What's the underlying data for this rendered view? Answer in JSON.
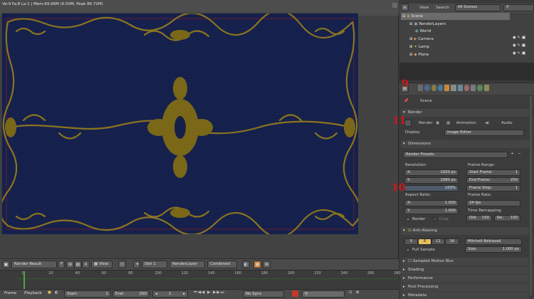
{
  "info": {
    "text": "Ve:9 Fa:8 La:1 | Mem:69.66M (0.00M, Peak 86.72M)"
  },
  "outliner": {
    "view_label": "View",
    "search_label": "Search",
    "scenes_label": "All Scenes",
    "rows": [
      {
        "label": "Scene"
      },
      {
        "label": "RenderLayers"
      },
      {
        "label": "World"
      },
      {
        "label": "Camera"
      },
      {
        "label": "Lamp"
      },
      {
        "label": "Plane"
      }
    ]
  },
  "properties": {
    "breadcrumb": "Scene",
    "render": {
      "title": "Render",
      "render_btn": "Render",
      "animation_btn": "Animation",
      "audio_btn": "Audio",
      "display_label": "Display:",
      "display_value": "Image Editor"
    },
    "dimensions": {
      "title": "Dimensions",
      "presets": "Render Presets",
      "resolution_label": "Resolution:",
      "res_x_label": "X:",
      "res_x": "1920 px",
      "res_y_label": "Y:",
      "res_y": "1080 px",
      "res_pct": "100%",
      "aspect_label": "Aspect Ratio:",
      "aspect_x_label": "X:",
      "aspect_x": "1.000",
      "aspect_y_label": "Y:",
      "aspect_y": "1.000",
      "border_label": "Border",
      "crop_label": "Crop",
      "frame_range_label": "Frame Range:",
      "start_label": "Start Frame:",
      "start_value": "1",
      "end_label": "End Frame:",
      "end_value": "250",
      "step_label": "Frame Step:",
      "step_value": "1",
      "frame_rate_label": "Frame Rate:",
      "frame_rate_value": "24 fps",
      "remap_label": "Time Remapping:",
      "old_label": "Old:",
      "old_value": "100",
      "new_label": "Ne:",
      "new_value": "100"
    },
    "aa": {
      "title": "Anti-Aliasing",
      "samples": [
        "5",
        "8",
        "11",
        "16"
      ],
      "filter": "Mitchell-Netravali",
      "full_sample": "Full Sample",
      "size_label": "Size:",
      "size_value": "1.000 px"
    },
    "collapsed": [
      {
        "title": "Sampled Motion Blur"
      },
      {
        "title": "Shading"
      },
      {
        "title": "Performance"
      },
      {
        "title": "Post Processing"
      },
      {
        "title": "Metadata"
      }
    ]
  },
  "annotations": {
    "a1": "9",
    "a2": "11",
    "a3": "10"
  },
  "image_editor": {
    "image_name": "Render Result",
    "f_label": "F",
    "view_menu": "View",
    "slot": "Slot 1",
    "layer": "RenderLayer",
    "pass": "Combined"
  },
  "timeline": {
    "ticks": [
      "0",
      "20",
      "40",
      "60",
      "80",
      "100",
      "120",
      "140",
      "160",
      "180",
      "200",
      "220",
      "240",
      "260",
      "280"
    ]
  },
  "bottom": {
    "frame_menu": "Frame",
    "playback_menu": "Playback",
    "start_label": "Start:",
    "start_value": "1",
    "end_label": "End:",
    "end_value": "250",
    "current": "1",
    "sync": "No Sync"
  }
}
